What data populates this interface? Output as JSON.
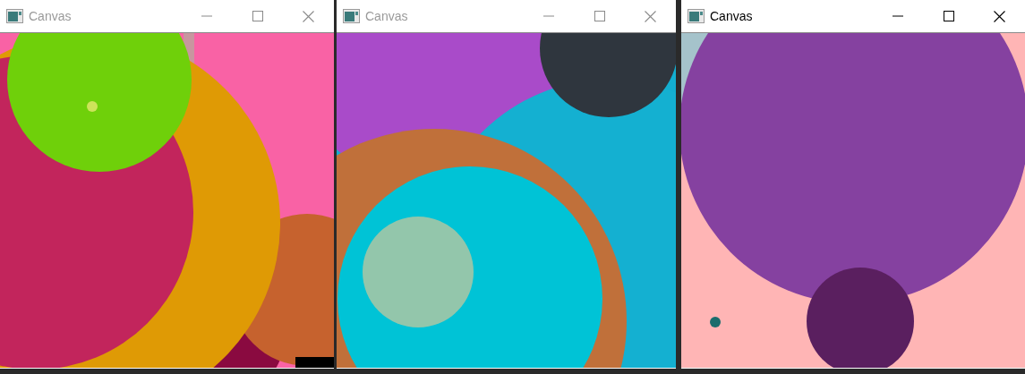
{
  "windows": [
    {
      "title": "Canvas",
      "active": false
    },
    {
      "title": "Canvas",
      "active": false
    },
    {
      "title": "Canvas",
      "active": true
    }
  ]
}
